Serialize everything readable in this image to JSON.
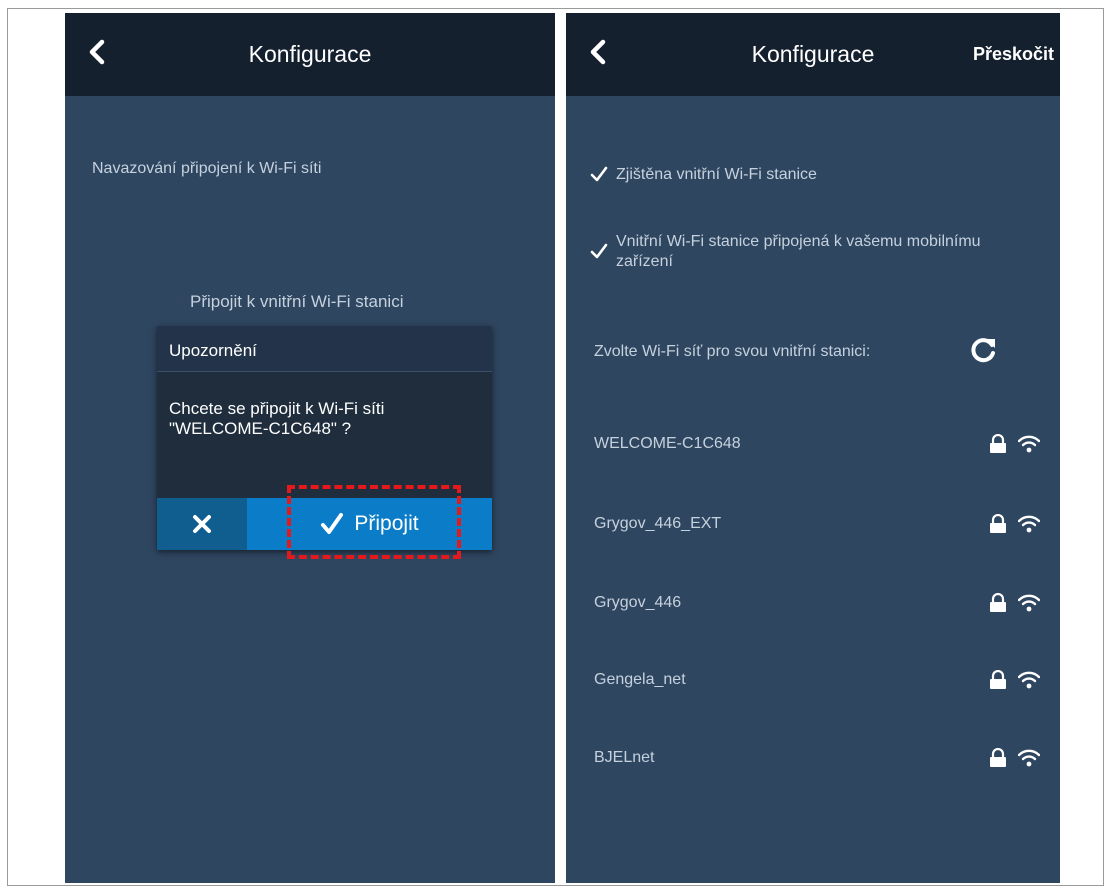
{
  "left_screen": {
    "header": {
      "title": "Konfigurace",
      "back_icon": "chevron-left-icon"
    },
    "status_text": "Navazování připojení k Wi-Fi síti",
    "connect_text": "Připojit k vnitřní Wi-Fi stanici",
    "dialog": {
      "title": "Upozornění",
      "message": "Chcete se připojit k Wi-Fi síti \"WELCOME-C1C648\" ?",
      "cancel_icon": "close-icon",
      "confirm_label": "Připojit",
      "confirm_icon": "check-icon"
    },
    "colors": {
      "highlight": "#e3191c",
      "button": "#0a7cc8"
    }
  },
  "right_screen": {
    "header": {
      "title": "Konfigurace",
      "skip_label": "Přeskočit",
      "back_icon": "chevron-left-icon"
    },
    "checks": [
      {
        "text": "Zjištěna vnitřní Wi-Fi stanice",
        "icon": "check-icon"
      },
      {
        "text": "Vnitřní Wi-Fi stanice připojená k vašemu mobilnímu zařízení",
        "icon": "check-icon"
      }
    ],
    "choose_text": "Zvolte Wi-Fi síť pro svou vnitřní stanici:",
    "refresh_icon": "refresh-icon",
    "networks": [
      {
        "name": "WELCOME-C1C648"
      },
      {
        "name": "Grygov_446_EXT"
      },
      {
        "name": "Grygov_446"
      },
      {
        "name": "Gengela_net"
      },
      {
        "name": "BJELnet"
      }
    ]
  }
}
